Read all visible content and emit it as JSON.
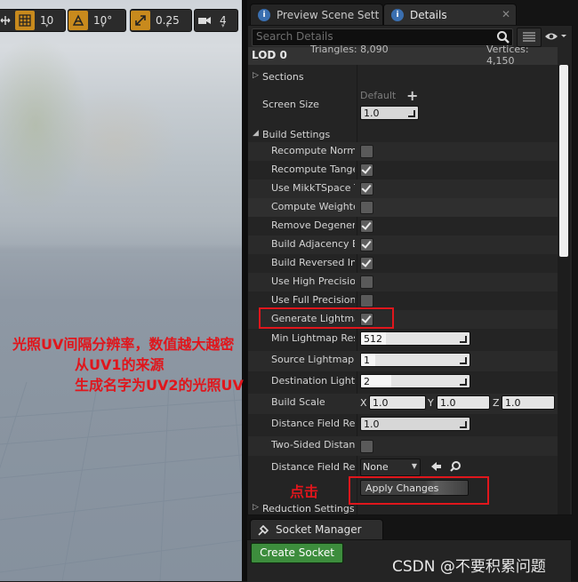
{
  "viewport_toolbar": {
    "grid_snap_value": "10",
    "rotation_snap_value": "10°",
    "scale_snap_value": "0.25",
    "camera_speed_value": "4"
  },
  "tabs": {
    "preview": "Preview Scene Sett",
    "details": "Details"
  },
  "details": {
    "search_placeholder": "Search Details",
    "lod_title": "LOD 0",
    "triangles_text": "Triangles: 8,090",
    "vertices_text": "Vertices: 4,150",
    "sections_label": "Sections",
    "screen_size_label": "Screen Size",
    "screen_size_default": "Default",
    "screen_size_value": "1.0",
    "build_settings_label": "Build Settings",
    "checks": [
      {
        "label": "Recompute Normals",
        "checked": false
      },
      {
        "label": "Recompute Tangents",
        "checked": true
      },
      {
        "label": "Use MikkTSpace Tangent Space",
        "checked": true
      },
      {
        "label": "Compute Weighted Normals",
        "checked": false
      },
      {
        "label": "Remove Degenerates",
        "checked": true
      },
      {
        "label": "Build Adjacency Buffer",
        "checked": true
      },
      {
        "label": "Build Reversed Index Buffer",
        "checked": true
      },
      {
        "label": "Use High Precision Tangent Basis",
        "checked": false
      },
      {
        "label": "Use Full Precision UVs",
        "checked": false
      },
      {
        "label": "Generate Lightmap UVs",
        "checked": true
      }
    ],
    "min_lightmap_label": "Min Lightmap Resolution",
    "min_lightmap_value": "512",
    "source_lightmap_label": "Source Lightmap Index",
    "source_lightmap_value": "1",
    "dest_lightmap_label": "Destination Lightmap Index",
    "dest_lightmap_value": "2",
    "build_scale_label": "Build Scale",
    "build_scale": {
      "x": "1.0",
      "y": "1.0",
      "z": "1.0"
    },
    "axis_x": "X",
    "axis_y": "Y",
    "axis_z": "Z",
    "distance_field_res_label": "Distance Field Resolution Scale",
    "distance_field_res_value": "1.0",
    "two_sided_label": "Two-Sided Distance Field Generation",
    "distance_field_rep_label": "Distance Field Replacement Mesh",
    "distance_field_rep_value": "None",
    "apply_changes_label": "Apply Changes",
    "reduction_label": "Reduction Settings"
  },
  "socket": {
    "tab_label": "Socket Manager",
    "create_button": "Create Socket"
  },
  "annotations": {
    "lightmap_note_1": "光照UV间隔分辨率，数值越大越密",
    "lightmap_note_2": "从UV1的来源",
    "lightmap_note_3": "生成名字为UV2的光照UV",
    "click_note": "点击",
    "watermark": "CSDN @不要积累问题"
  },
  "colors": {
    "annotation_red": "#e0161c",
    "create_socket_green": "#3d8d3d",
    "panel_bg": "#242424"
  }
}
